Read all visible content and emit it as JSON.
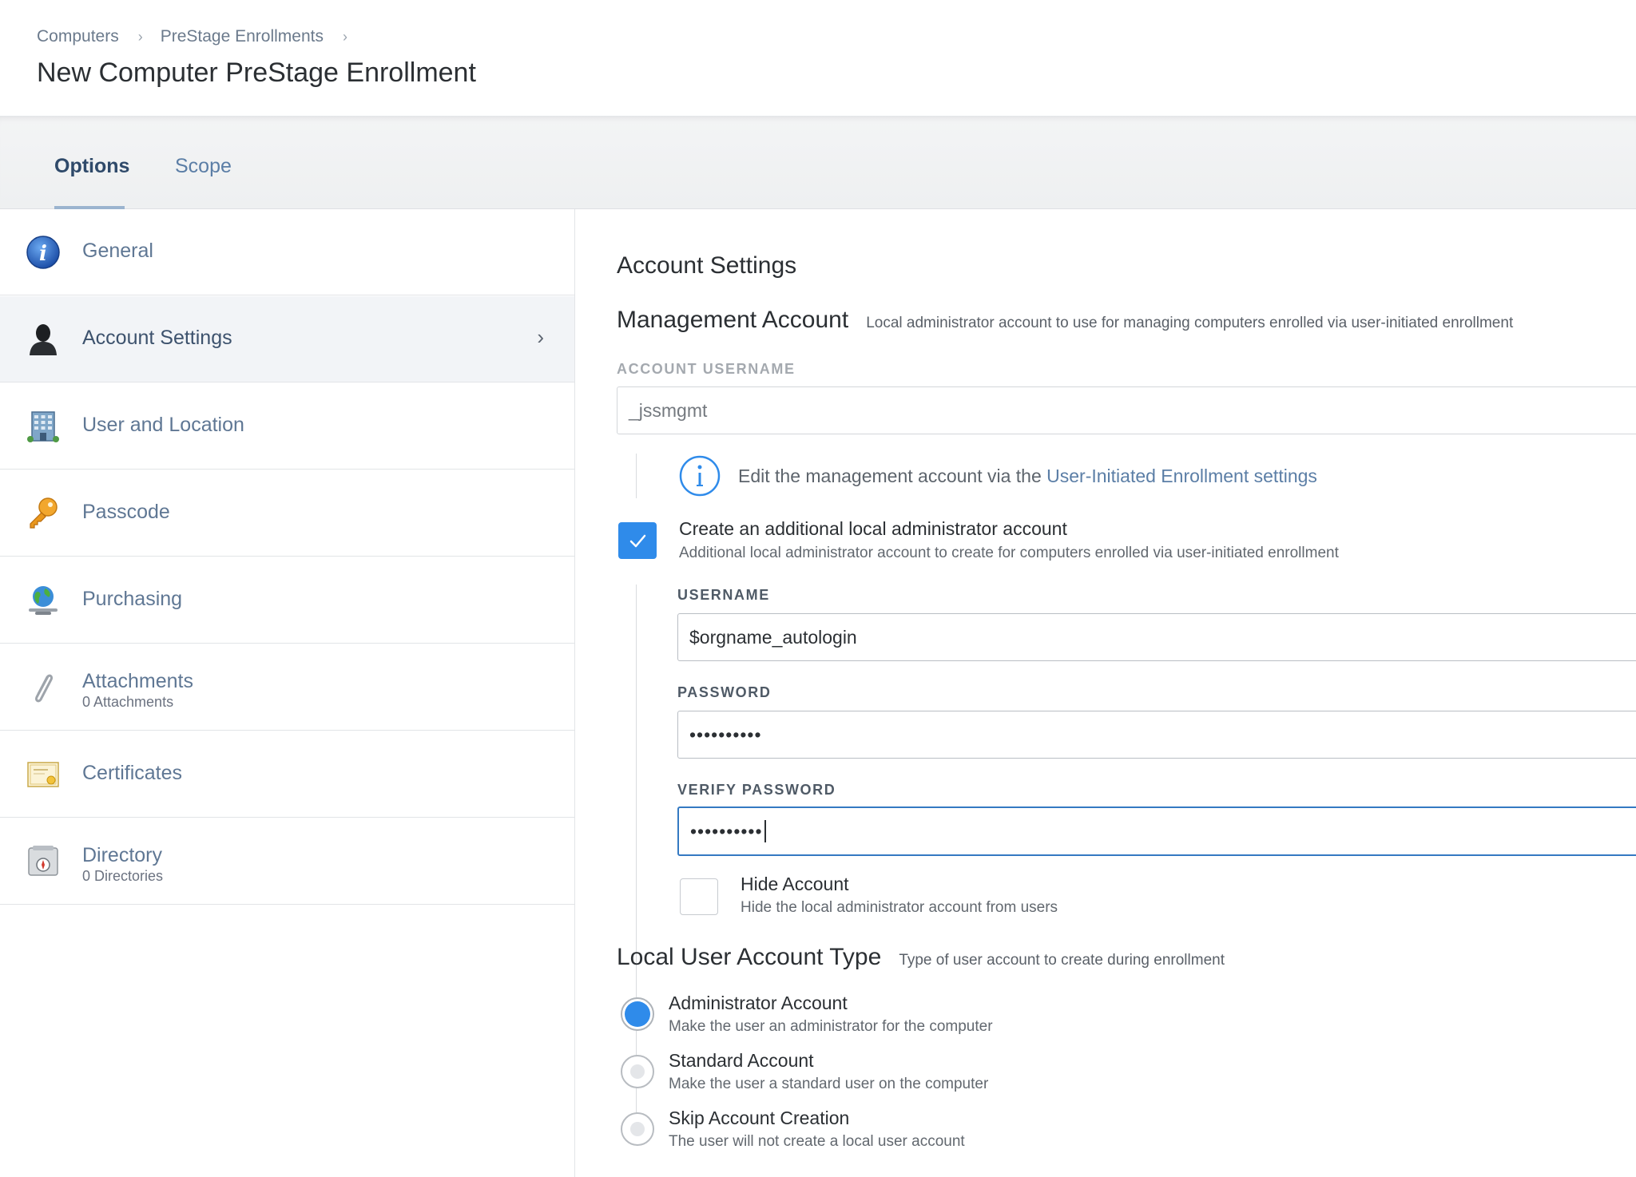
{
  "breadcrumb": {
    "items": [
      "Computers",
      "PreStage Enrollments"
    ]
  },
  "page_title": "New Computer PreStage Enrollment",
  "tabs": [
    {
      "label": "Options",
      "active": true
    },
    {
      "label": "Scope",
      "active": false
    }
  ],
  "sidebar": {
    "items": [
      {
        "label": "General",
        "icon": "info-icon"
      },
      {
        "label": "Account Settings",
        "icon": "user-silhouette-icon",
        "active": true
      },
      {
        "label": "User and Location",
        "icon": "building-icon"
      },
      {
        "label": "Passcode",
        "icon": "key-icon"
      },
      {
        "label": "Purchasing",
        "icon": "globe-icon"
      },
      {
        "label": "Attachments",
        "sub": "0 Attachments",
        "icon": "paperclip-icon"
      },
      {
        "label": "Certificates",
        "icon": "certificate-icon"
      },
      {
        "label": "Directory",
        "sub": "0 Directories",
        "icon": "directory-icon"
      }
    ]
  },
  "main": {
    "section_title": "Account Settings",
    "management": {
      "title": "Management Account",
      "description": "Local administrator account to use for managing computers enrolled via user-initiated enrollment",
      "username_label": "ACCOUNT USERNAME",
      "username_value": "_jssmgmt",
      "info_text": "Edit the management account via the",
      "info_link": "User-Initiated Enrollment settings"
    },
    "additional_admin": {
      "checked": true,
      "title": "Create an additional local administrator account",
      "description": "Additional local administrator account to create for computers enrolled via user-initiated enrollment",
      "username_label": "USERNAME",
      "username_value": "$orgname_autologin",
      "password_label": "PASSWORD",
      "password_value": "••••••••••",
      "verify_label": "VERIFY PASSWORD",
      "verify_value": "••••••••••",
      "hide_account": {
        "checked": false,
        "title": "Hide Account",
        "description": "Hide the local administrator account from users"
      }
    },
    "local_user": {
      "title": "Local User Account Type",
      "description": "Type of user account to create during enrollment",
      "options": [
        {
          "title": "Administrator Account",
          "description": "Make the user an administrator for the computer",
          "selected": true
        },
        {
          "title": "Standard Account",
          "description": "Make the user a standard user on the computer",
          "selected": false
        },
        {
          "title": "Skip Account Creation",
          "description": "The user will not create a local user account",
          "selected": false
        }
      ]
    }
  },
  "colors": {
    "accent": "#2f8bea",
    "link": "#5b7ea6",
    "focus_border": "#3479c2"
  }
}
